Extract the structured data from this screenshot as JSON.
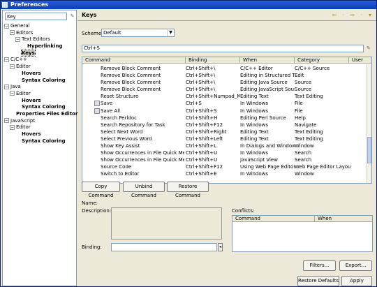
{
  "window": {
    "title": "Preferences"
  },
  "left": {
    "filter_value": "Key",
    "tree": [
      {
        "label": "General",
        "twist": "⊟",
        "indent": 0,
        "bold": false
      },
      {
        "label": "Editors",
        "twist": "⊟",
        "indent": 1,
        "bold": false
      },
      {
        "label": "Text Editors",
        "twist": "⊟",
        "indent": 2,
        "bold": false
      },
      {
        "label": "Hyperlinking",
        "twist": "",
        "indent": 3,
        "bold": true
      },
      {
        "label": "Keys",
        "twist": "",
        "indent": 2,
        "bold": true,
        "selected": true
      },
      {
        "label": "C/C++",
        "twist": "⊟",
        "indent": 0,
        "bold": false
      },
      {
        "label": "Editor",
        "twist": "⊟",
        "indent": 1,
        "bold": false
      },
      {
        "label": "Hovers",
        "twist": "",
        "indent": 2,
        "bold": true
      },
      {
        "label": "Syntax Coloring",
        "twist": "",
        "indent": 2,
        "bold": true
      },
      {
        "label": "Java",
        "twist": "⊟",
        "indent": 0,
        "bold": false
      },
      {
        "label": "Editor",
        "twist": "⊟",
        "indent": 1,
        "bold": false
      },
      {
        "label": "Hovers",
        "twist": "",
        "indent": 2,
        "bold": true
      },
      {
        "label": "Syntax Coloring",
        "twist": "",
        "indent": 2,
        "bold": true
      },
      {
        "label": "Properties Files Editor",
        "twist": "",
        "indent": 1,
        "bold": true
      },
      {
        "label": "JavaScript",
        "twist": "⊟",
        "indent": 0,
        "bold": false
      },
      {
        "label": "Editor",
        "twist": "⊟",
        "indent": 1,
        "bold": false
      },
      {
        "label": "Hovers",
        "twist": "",
        "indent": 2,
        "bold": true
      },
      {
        "label": "Syntax Coloring",
        "twist": "",
        "indent": 2,
        "bold": true
      }
    ]
  },
  "page": {
    "title": "Keys",
    "nav_icons": "⇦ · ⇨ · ▾",
    "scheme_label": "Scheme:",
    "scheme_value": "Default",
    "filter_value": "Ctrl+S",
    "columns": [
      "Command",
      "Binding",
      "When",
      "Category",
      "User"
    ],
    "rows": [
      {
        "command": "Remove Block Comment",
        "binding": "Ctrl+Shift+\\",
        "when": "C/C++ Editor",
        "category": "C/C++ Source",
        "icon": false
      },
      {
        "command": "Remove Block Comment",
        "binding": "Ctrl+Shift+\\",
        "when": "Editing in Structured T...",
        "category": "Edit",
        "icon": false
      },
      {
        "command": "Remove Block Comment",
        "binding": "Ctrl+Shift+\\",
        "when": "Editing Java Source",
        "category": "Source",
        "icon": false
      },
      {
        "command": "Remove Block Comment",
        "binding": "Ctrl+Shift+\\",
        "when": "Editing JavaScript Source",
        "category": "Source",
        "icon": false
      },
      {
        "command": "Reset Structure",
        "binding": "Ctrl+Shift+Numpad_M...",
        "when": "Editing Text",
        "category": "Text Editing",
        "icon": false
      },
      {
        "command": "Save",
        "binding": "Ctrl+S",
        "when": "In Windows",
        "category": "File",
        "icon": true
      },
      {
        "command": "Save All",
        "binding": "Ctrl+Shift+S",
        "when": "In Windows",
        "category": "File",
        "icon": true
      },
      {
        "command": "Search Perldoc",
        "binding": "Ctrl+Shift+H",
        "when": "Editing Perl Source",
        "category": "Help",
        "icon": false
      },
      {
        "command": "Search Repository for Task",
        "binding": "Ctrl+Shift+F12",
        "when": "In Windows",
        "category": "Navigate",
        "icon": false
      },
      {
        "command": "Select Next Word",
        "binding": "Ctrl+Shift+Right",
        "when": "Editing Text",
        "category": "Text Editing",
        "icon": false
      },
      {
        "command": "Select Previous Word",
        "binding": "Ctrl+Shift+Left",
        "when": "Editing Text",
        "category": "Text Editing",
        "icon": false
      },
      {
        "command": "Show Key Assist",
        "binding": "Ctrl+Shift+L",
        "when": "In Dialogs and Windows",
        "category": "Window",
        "icon": false
      },
      {
        "command": "Show Occurrences in File Quick Menu",
        "binding": "Ctrl+Shift+U",
        "when": "In Windows",
        "category": "Search",
        "icon": false
      },
      {
        "command": "Show Occurrences in File Quick Menu",
        "binding": "Ctrl+Shift+U",
        "when": "JavaScript View",
        "category": "Search",
        "icon": false
      },
      {
        "command": "Source Code",
        "binding": "Ctrl+Shift+F12",
        "when": "Using Web Page Editor",
        "category": "Web Page Editor Layout",
        "icon": false
      },
      {
        "command": "Switch to Editor",
        "binding": "Ctrl+Shift+E",
        "when": "In Windows",
        "category": "Window",
        "icon": false
      }
    ],
    "buttons": {
      "copy": "Copy Command",
      "unbind": "Unbind Command",
      "restore": "Restore Command"
    },
    "name_label": "Name:",
    "description_label": "Description:",
    "binding_label": "Binding:",
    "conflicts_label": "Conflicts:",
    "conflict_columns": [
      "Command",
      "When"
    ],
    "filters_button": "Filters...",
    "export_button": "Export...",
    "restore_defaults_button": "Restore Defaults",
    "apply_button": "Apply"
  }
}
